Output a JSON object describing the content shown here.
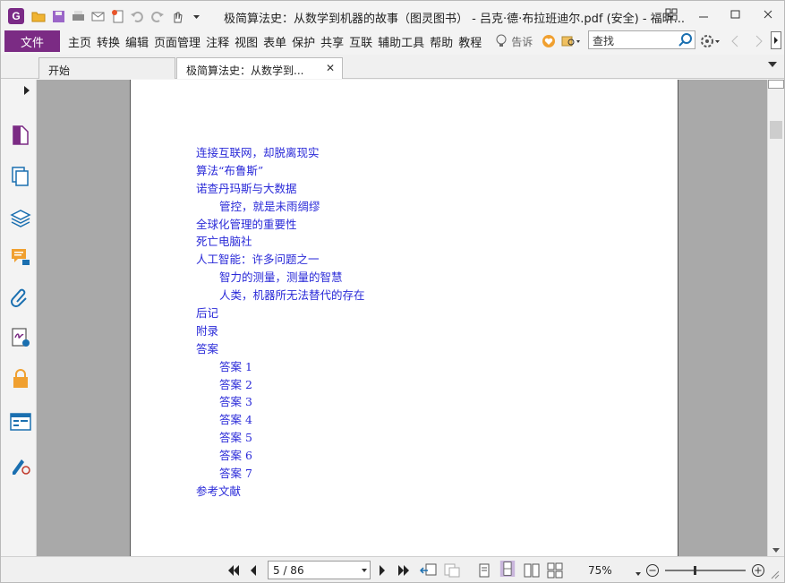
{
  "window": {
    "title": "极简算法史：从数学到机器的故事（图灵图书） - 吕克·德·布拉班迪尔.pdf (安全) - 福昕..."
  },
  "menu": {
    "file_label": "文件",
    "items": [
      "主页",
      "转换",
      "编辑",
      "页面管理",
      "注释",
      "视图",
      "表单",
      "保护",
      "共享",
      "互联",
      "辅助工具",
      "帮助",
      "教程"
    ],
    "tell_me_label": "告诉",
    "search_placeholder": "查找"
  },
  "tabs": [
    {
      "label": "开始"
    },
    {
      "label": "极简算法史：从数学到...",
      "close": "✕"
    }
  ],
  "toc": [
    {
      "text": "连接互联网，却脱离现实",
      "indent": false
    },
    {
      "text": "算法“布鲁斯”",
      "indent": false
    },
    {
      "text": "诺查丹玛斯与大数据",
      "indent": false
    },
    {
      "text": "管控，就是未雨绸缪",
      "indent": true
    },
    {
      "text": "全球化管理的重要性",
      "indent": false
    },
    {
      "text": "死亡电脑社",
      "indent": false
    },
    {
      "text": "人工智能：许多问题之一",
      "indent": false
    },
    {
      "text": "智力的测量，测量的智慧",
      "indent": true
    },
    {
      "text": "人类，机器所无法替代的存在",
      "indent": true
    },
    {
      "text": "后记",
      "indent": false
    },
    {
      "text": "附录",
      "indent": false
    },
    {
      "text": "答案",
      "indent": false
    },
    {
      "text": "答案 1",
      "indent": true
    },
    {
      "text": "答案 2",
      "indent": true
    },
    {
      "text": "答案 3",
      "indent": true
    },
    {
      "text": "答案 4",
      "indent": true
    },
    {
      "text": "答案 5",
      "indent": true
    },
    {
      "text": "答案 6",
      "indent": true
    },
    {
      "text": "答案 7",
      "indent": true
    },
    {
      "text": "参考文献",
      "indent": false
    }
  ],
  "status": {
    "page_indicator": "5 / 86",
    "zoom": "75%",
    "zoom_slider_fraction": 0.35
  },
  "colors": {
    "brand": "#7b2b84",
    "toc_link": "#2a2ad8",
    "page_bg": "#a9a9a9"
  },
  "icons": {
    "sidebar": [
      "page-thumbnail-icon",
      "pages-icon",
      "layers-icon",
      "comments-icon",
      "attachments-icon",
      "signature-icon",
      "security-icon",
      "form-fields-icon",
      "certify-icon"
    ]
  }
}
